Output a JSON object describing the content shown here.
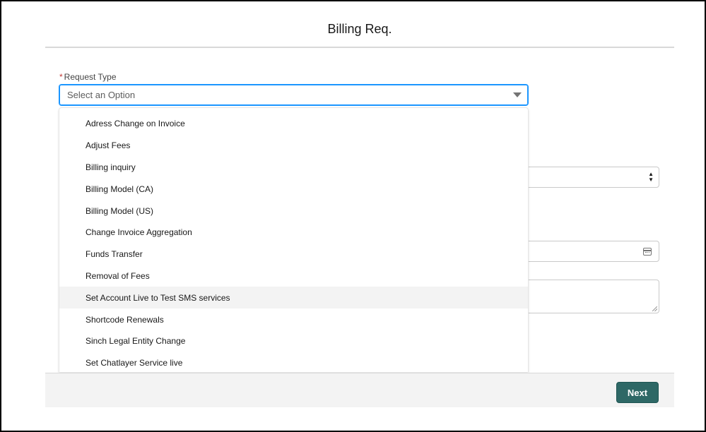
{
  "modal": {
    "title": "Billing Req."
  },
  "request_type": {
    "label": "Request Type",
    "required_marker": "*",
    "placeholder": "Select an Option",
    "options": [
      "Adress Change on Invoice",
      "Adjust Fees",
      "Billing inquiry",
      "Billing Model (CA)",
      "Billing Model (US)",
      "Change Invoice Aggregation",
      "Funds Transfer",
      "Removal of Fees",
      "Set Account Live to Test SMS services",
      "Shortcode Renewals",
      "Sinch Legal Entity Change",
      "Set Chatlayer Service live"
    ],
    "hovered_option_index": 8
  },
  "footer": {
    "next_label": "Next"
  },
  "colors": {
    "accent": "#1b96ff",
    "button": "#2e6866",
    "required": "#c23934"
  },
  "icons": {
    "combobox": "chevron-down-icon",
    "date": "calendar-icon"
  }
}
